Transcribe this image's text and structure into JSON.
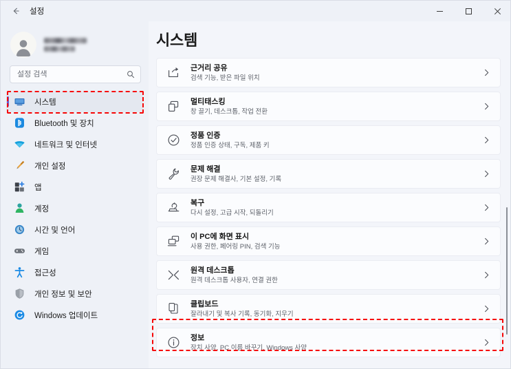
{
  "window": {
    "title": "설정",
    "back_icon": "back-arrow-icon",
    "controls": [
      {
        "name": "minimize",
        "icon": "minimize-icon"
      },
      {
        "name": "maximize",
        "icon": "maximize-icon"
      },
      {
        "name": "close",
        "icon": "close-icon"
      }
    ]
  },
  "sidebar": {
    "account": {
      "avatar_icon": "user-avatar-icon",
      "name_redacted": true,
      "email_redacted": true
    },
    "search": {
      "placeholder": "설정 검색",
      "value": "",
      "icon": "search-icon"
    },
    "items": [
      {
        "label": "시스템",
        "icon": "monitor-icon",
        "selected": true
      },
      {
        "label": "Bluetooth 및 장치",
        "icon": "bluetooth-icon",
        "selected": false
      },
      {
        "label": "네트워크 및 인터넷",
        "icon": "wifi-icon",
        "selected": false
      },
      {
        "label": "개인 설정",
        "icon": "paintbrush-icon",
        "selected": false
      },
      {
        "label": "앱",
        "icon": "apps-icon",
        "selected": false
      },
      {
        "label": "계정",
        "icon": "account-person-icon",
        "selected": false
      },
      {
        "label": "시간 및 언어",
        "icon": "clock-globe-icon",
        "selected": false
      },
      {
        "label": "게임",
        "icon": "gamepad-icon",
        "selected": false
      },
      {
        "label": "접근성",
        "icon": "accessibility-person-icon",
        "selected": false
      },
      {
        "label": "개인 정보 및 보안",
        "icon": "shield-icon",
        "selected": false
      },
      {
        "label": "Windows 업데이트",
        "icon": "update-refresh-icon",
        "selected": false
      }
    ]
  },
  "main": {
    "page_title": "시스템",
    "cards": [
      {
        "title": "근거리 공유",
        "subtitle": "검색 기능, 받은 파일 위치",
        "icon": "share-nearby-icon",
        "chevron": "chevron-right-icon",
        "highlighted": false
      },
      {
        "title": "멀티태스킹",
        "subtitle": "창 끌기, 데스크톱, 작업 전환",
        "icon": "multitasking-windows-icon",
        "chevron": "chevron-right-icon",
        "highlighted": false
      },
      {
        "title": "정품 인증",
        "subtitle": "정품 인증 상태, 구독, 제품 키",
        "icon": "check-circle-icon",
        "chevron": "chevron-right-icon",
        "highlighted": false
      },
      {
        "title": "문제 해결",
        "subtitle": "권장 문제 해결사, 기본 설정, 기록",
        "icon": "wrench-icon",
        "chevron": "chevron-right-icon",
        "highlighted": false
      },
      {
        "title": "복구",
        "subtitle": "다시 설정, 고급 시작, 되돌리기",
        "icon": "recovery-icon",
        "chevron": "chevron-right-icon",
        "highlighted": false
      },
      {
        "title": "이 PC에 화면 표시",
        "subtitle": "사용 권한, 페어링 PIN, 검색 기능",
        "icon": "project-to-pc-icon",
        "chevron": "chevron-right-icon",
        "highlighted": false
      },
      {
        "title": "원격 데스크톱",
        "subtitle": "원격 데스크톱 사용자, 연결 권한",
        "icon": "remote-desktop-icon",
        "chevron": "chevron-right-icon",
        "highlighted": false
      },
      {
        "title": "클립보드",
        "subtitle": "잘라내기 및 복사 기록, 동기화, 지우기",
        "icon": "clipboard-icon",
        "chevron": "chevron-right-icon",
        "highlighted": false
      },
      {
        "title": "정보",
        "subtitle": "장치 사양, PC 이름 바꾸기, Windows 사양",
        "icon": "info-circle-icon",
        "chevron": "chevron-right-icon",
        "highlighted": true
      }
    ]
  },
  "annotations": {
    "color": "#f60505",
    "boxes": [
      {
        "target": "sidebar-item-시스템",
        "style": "dashed"
      },
      {
        "target": "card-정보",
        "style": "dashed"
      }
    ]
  },
  "colors": {
    "window_bg": "#f3f5fa",
    "sidebar_bg": "#eef1f7",
    "card_bg": "#fbfcfe",
    "selection_accent": "#6b5bd2",
    "annotation_red": "#f60505",
    "text_primary": "#161616",
    "text_secondary": "#5d6169"
  }
}
